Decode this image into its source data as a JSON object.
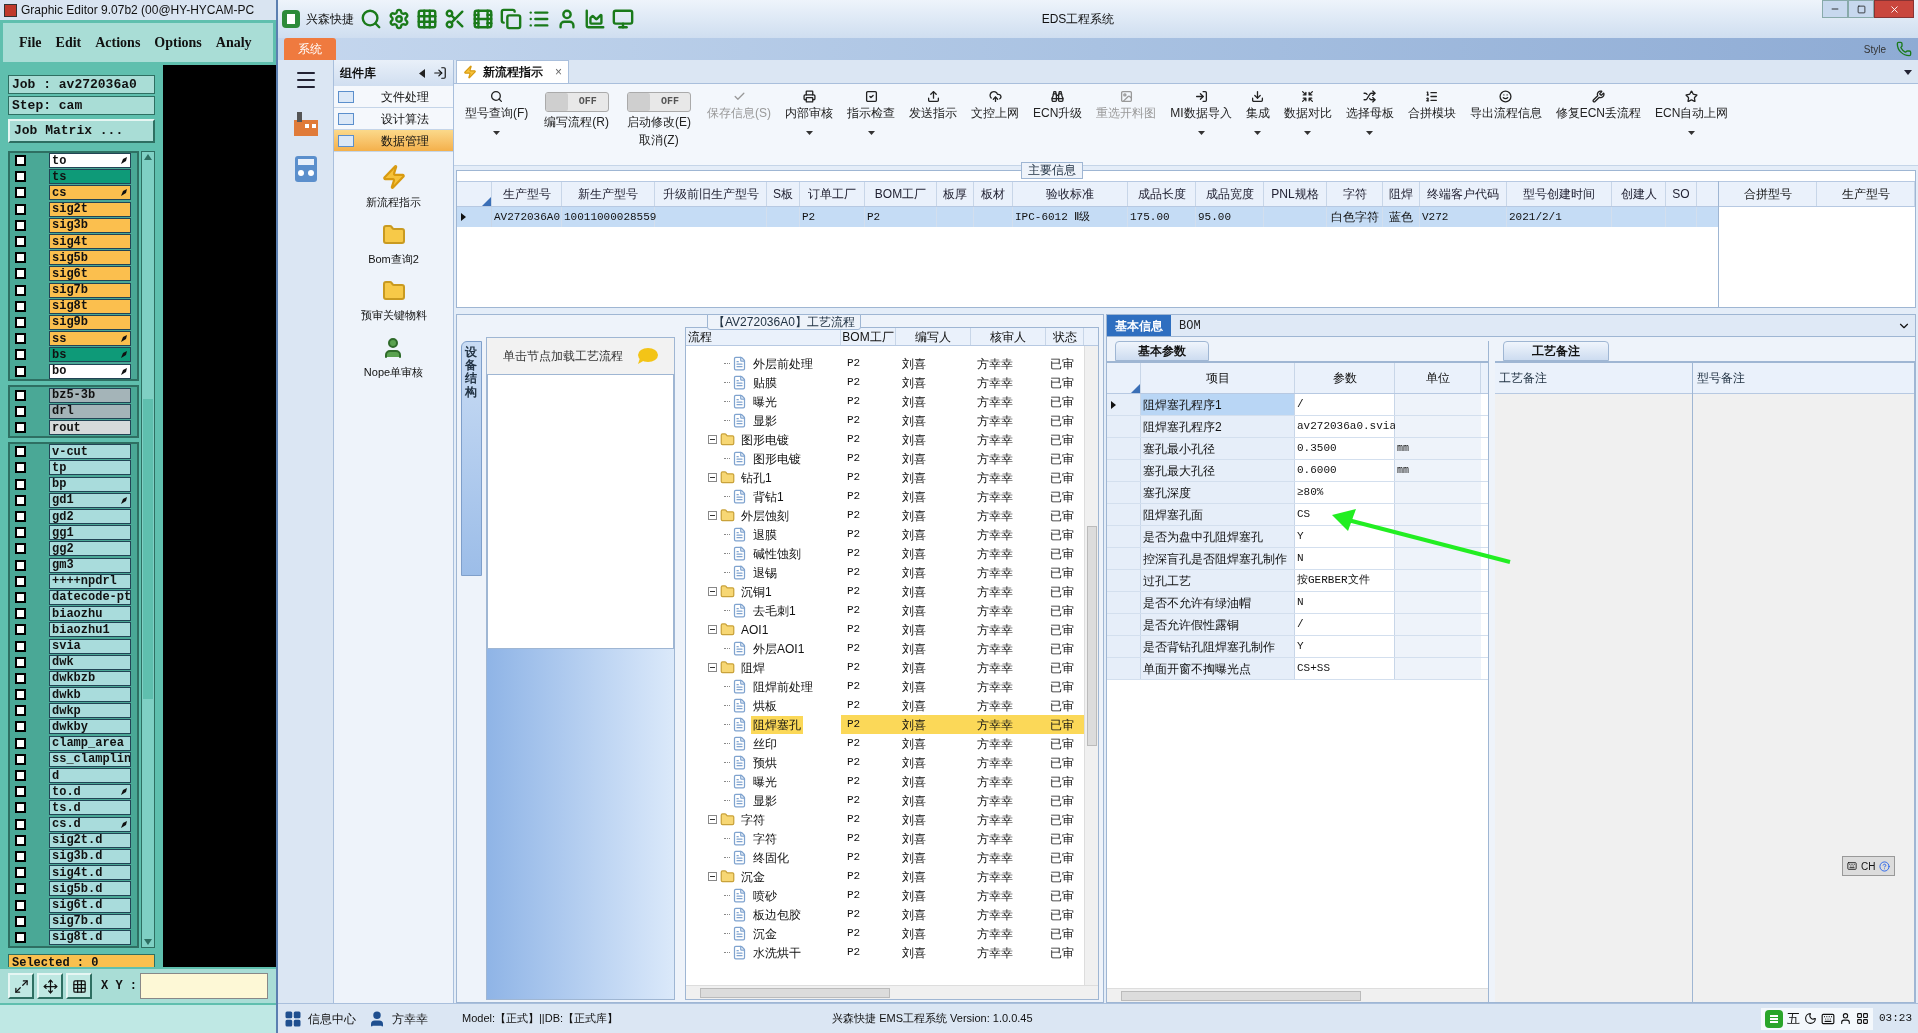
{
  "editor": {
    "title": "Graphic Editor 9.07b2 (00@HY-HYCAM-PC",
    "menu": [
      "File",
      "Edit",
      "Actions",
      "Options",
      "Analy"
    ],
    "job": "Job : av272036a0",
    "step": "Step: cam",
    "matrix_button": "Job Matrix ...",
    "layer_groups": [
      [
        {
          "name": "to",
          "color": "#ffffff",
          "flag": true,
          "checked": false
        },
        {
          "name": "ts",
          "color": "#0e9a78",
          "flag": false,
          "checked": false
        },
        {
          "name": "cs",
          "color": "#fbbf4e",
          "flag": true,
          "checked": false
        },
        {
          "name": "sig2t",
          "color": "#fbbf4e",
          "flag": false,
          "checked": false
        },
        {
          "name": "sig3b",
          "color": "#fbbf4e",
          "flag": false,
          "checked": false
        },
        {
          "name": "sig4t",
          "color": "#fbbf4e",
          "flag": false,
          "checked": false
        },
        {
          "name": "sig5b",
          "color": "#fbbf4e",
          "flag": false,
          "checked": false
        },
        {
          "name": "sig6t",
          "color": "#fbbf4e",
          "flag": false,
          "checked": false
        },
        {
          "name": "sig7b",
          "color": "#fbbf4e",
          "flag": false,
          "checked": false
        },
        {
          "name": "sig8t",
          "color": "#fbbf4e",
          "flag": false,
          "checked": false
        },
        {
          "name": "sig9b",
          "color": "#fbbf4e",
          "flag": false,
          "checked": false
        },
        {
          "name": "ss",
          "color": "#fbbf4e",
          "flag": true,
          "checked": false
        },
        {
          "name": "bs",
          "color": "#0e9a78",
          "flag": true,
          "checked": false
        },
        {
          "name": "bo",
          "color": "#ffffff",
          "flag": true,
          "checked": false
        }
      ],
      [
        {
          "name": "bz5-3b",
          "color": "#a4b4b8",
          "flag": false,
          "checked": false
        },
        {
          "name": "drl",
          "color": "#a4b4b8",
          "flag": false,
          "checked": false
        },
        {
          "name": "rout",
          "color": "#d6dadb",
          "flag": false,
          "checked": false
        }
      ],
      [
        {
          "name": "v-cut",
          "color": "#a9dcdc",
          "flag": false,
          "checked": false
        },
        {
          "name": "tp",
          "color": "#a9dcdc",
          "flag": false,
          "checked": false
        },
        {
          "name": "bp",
          "color": "#a9dcdc",
          "flag": false,
          "checked": false
        },
        {
          "name": "gd1",
          "color": "#a9dcdc",
          "flag": true,
          "checked": false
        },
        {
          "name": "gd2",
          "color": "#a9dcdc",
          "flag": false,
          "checked": false
        },
        {
          "name": "gg1",
          "color": "#a9dcdc",
          "flag": false,
          "checked": false
        },
        {
          "name": "gg2",
          "color": "#a9dcdc",
          "flag": false,
          "checked": false
        },
        {
          "name": "gm3",
          "color": "#a9dcdc",
          "flag": false,
          "checked": false
        },
        {
          "name": "++++npdrl",
          "color": "#a9dcdc",
          "flag": false,
          "checked": false
        },
        {
          "name": "datecode-pt",
          "color": "#a9dcdc",
          "flag": false,
          "checked": false
        },
        {
          "name": "biaozhu",
          "color": "#a9dcdc",
          "flag": false,
          "checked": false
        },
        {
          "name": "biaozhu1",
          "color": "#a9dcdc",
          "flag": false,
          "checked": false
        },
        {
          "name": "svia",
          "color": "#a9dcdc",
          "flag": false,
          "checked": false
        },
        {
          "name": "dwk",
          "color": "#a9dcdc",
          "flag": false,
          "checked": false
        },
        {
          "name": "dwkbzb",
          "color": "#a9dcdc",
          "flag": false,
          "checked": false
        },
        {
          "name": "dwkb",
          "color": "#a9dcdc",
          "flag": false,
          "checked": false
        },
        {
          "name": "dwkp",
          "color": "#a9dcdc",
          "flag": false,
          "checked": false
        },
        {
          "name": "dwkby",
          "color": "#a9dcdc",
          "flag": false,
          "checked": false
        },
        {
          "name": "clamp_area",
          "color": "#a9dcdc",
          "flag": false,
          "checked": false
        },
        {
          "name": "ss_clamplin",
          "color": "#a9dcdc",
          "flag": false,
          "checked": false
        },
        {
          "name": "d",
          "color": "#a9dcdc",
          "flag": false,
          "checked": false
        },
        {
          "name": "to.d",
          "color": "#a9dcdc",
          "flag": true,
          "checked": false
        },
        {
          "name": "ts.d",
          "color": "#a9dcdc",
          "flag": false,
          "checked": false
        },
        {
          "name": "cs.d",
          "color": "#a9dcdc",
          "flag": true,
          "checked": false
        },
        {
          "name": "sig2t.d",
          "color": "#a9dcdc",
          "flag": false,
          "checked": false
        },
        {
          "name": "sig3b.d",
          "color": "#a9dcdc",
          "flag": false,
          "checked": false
        },
        {
          "name": "sig4t.d",
          "color": "#a9dcdc",
          "flag": false,
          "checked": false
        },
        {
          "name": "sig5b.d",
          "color": "#a9dcdc",
          "flag": false,
          "checked": false
        },
        {
          "name": "sig6t.d",
          "color": "#a9dcdc",
          "flag": false,
          "checked": false
        },
        {
          "name": "sig7b.d",
          "color": "#a9dcdc",
          "flag": false,
          "checked": false
        },
        {
          "name": "sig8t.d",
          "color": "#a9dcdc",
          "flag": false,
          "checked": false
        }
      ]
    ],
    "selected": "Selected : 0",
    "xy_label": "X Y :"
  },
  "eds": {
    "app_name": "兴森快捷",
    "window_title": "EDS工程系统",
    "system_tab": "系统",
    "style_label": "Style",
    "component_title": "组件库",
    "nav_items": [
      {
        "label": "文件处理",
        "selected": false
      },
      {
        "label": "设计算法",
        "selected": false
      },
      {
        "label": "数据管理",
        "selected": true
      }
    ],
    "tools": [
      {
        "label": "新流程指示",
        "kind": "bolt"
      },
      {
        "label": "Bom查询2",
        "kind": "folder"
      },
      {
        "label": "预审关键物料",
        "kind": "folder"
      },
      {
        "label": "Nope单审核",
        "kind": "user"
      }
    ],
    "doc_tab": {
      "label": "新流程指示",
      "close": "×"
    },
    "ribbon": [
      {
        "kind": "button",
        "lines": [
          "型号查询(F)"
        ],
        "dropdown": true,
        "disabled": false
      },
      {
        "kind": "toggle",
        "lines": [
          "编写流程(R)"
        ],
        "switch_text": "OFF",
        "on": false
      },
      {
        "kind": "toggle",
        "lines": [
          "启动修改(E)",
          "取消(Z)"
        ],
        "switch_text": "OFF",
        "on": false
      },
      {
        "kind": "button",
        "lines": [
          "保存信息(S)"
        ],
        "dropdown": false,
        "disabled": true
      },
      {
        "kind": "button",
        "lines": [
          "内部审核"
        ],
        "dropdown": true,
        "disabled": false
      },
      {
        "kind": "button",
        "lines": [
          "指示检查"
        ],
        "dropdown": true,
        "disabled": false
      },
      {
        "kind": "button",
        "lines": [
          "发送指示"
        ],
        "dropdown": false,
        "disabled": false
      },
      {
        "kind": "button",
        "lines": [
          "文控上网"
        ],
        "dropdown": false,
        "disabled": false
      },
      {
        "kind": "button",
        "lines": [
          "ECN升级"
        ],
        "dropdown": false,
        "disabled": false
      },
      {
        "kind": "button",
        "lines": [
          "重选开料图"
        ],
        "dropdown": false,
        "disabled": true
      },
      {
        "kind": "button",
        "lines": [
          "MI数据导入"
        ],
        "dropdown": true,
        "disabled": false
      },
      {
        "kind": "button",
        "lines": [
          "集成"
        ],
        "dropdown": true,
        "disabled": false
      },
      {
        "kind": "button",
        "lines": [
          "数据对比"
        ],
        "dropdown": true,
        "disabled": false
      },
      {
        "kind": "button",
        "lines": [
          "选择母板"
        ],
        "dropdown": true,
        "disabled": false
      },
      {
        "kind": "button",
        "lines": [
          "合拼模块"
        ],
        "dropdown": false,
        "disabled": false
      },
      {
        "kind": "button",
        "lines": [
          "导出流程信息"
        ],
        "dropdown": false,
        "disabled": false
      },
      {
        "kind": "button",
        "lines": [
          "修复ECN丢流程"
        ],
        "dropdown": false,
        "disabled": false
      },
      {
        "kind": "button",
        "lines": [
          "ECN自动上网"
        ],
        "dropdown": true,
        "disabled": false
      }
    ],
    "main_info": {
      "title": "主要信息",
      "columns": [
        "生产型号",
        "新生产型号",
        "升级前旧生产型号",
        "S板",
        "订单工厂",
        "BOM工厂",
        "板厚",
        "板材",
        "验收标准",
        "成品长度",
        "成品宽度",
        "PNL规格",
        "字符",
        "阻焊",
        "终端客户代码",
        "型号创建时间",
        "创建人",
        "SO"
      ],
      "rows": [
        {
          "selected": true,
          "cells": [
            "AV272036A0",
            "10011000028559",
            "",
            "",
            "P2",
            "P2",
            "",
            "",
            "IPC-6012 Ⅱ级",
            "175.00",
            "95.00",
            "",
            "白色字符",
            "蓝色",
            "V272",
            "2021/2/1",
            "",
            ""
          ]
        }
      ],
      "side_columns": [
        "合拼型号",
        "生产型号"
      ]
    },
    "flow": {
      "title": "【AV272036A0】工艺流程",
      "side_tab": "设备结构",
      "hint": "单击节点加载工艺流程",
      "columns": [
        "流程",
        "BOM工厂",
        "编写人",
        "核审人",
        "状态"
      ],
      "nodes": [
        {
          "children": [
            {
              "label": "外层前处理",
              "bom": "P2",
              "writer": "刘喜",
              "reviewer": "方幸幸",
              "status": "已审",
              "selected": false
            },
            {
              "label": "贴膜",
              "bom": "P2",
              "writer": "刘喜",
              "reviewer": "方幸幸",
              "status": "已审",
              "selected": false
            },
            {
              "label": "曝光",
              "bom": "P2",
              "writer": "刘喜",
              "reviewer": "方幸幸",
              "status": "已审",
              "selected": false
            },
            {
              "label": "显影",
              "bom": "P2",
              "writer": "刘喜",
              "reviewer": "方幸幸",
              "status": "已审",
              "selected": false
            }
          ]
        },
        {
          "label": "图形电镀",
          "bom": "P2",
          "writer": "刘喜",
          "reviewer": "方幸幸",
          "status": "已审",
          "selected": false,
          "children": [
            {
              "label": "图形电镀",
              "bom": "P2",
              "writer": "刘喜",
              "reviewer": "方幸幸",
              "status": "已审",
              "selected": false
            }
          ]
        },
        {
          "label": "钻孔1",
          "bom": "P2",
          "writer": "刘喜",
          "reviewer": "方幸幸",
          "status": "已审",
          "selected": false,
          "children": [
            {
              "label": "背钻1",
              "bom": "P2",
              "writer": "刘喜",
              "reviewer": "方幸幸",
              "status": "已审",
              "selected": false
            }
          ]
        },
        {
          "label": "外层蚀刻",
          "bom": "P2",
          "writer": "刘喜",
          "reviewer": "方幸幸",
          "status": "已审",
          "selected": false,
          "children": [
            {
              "label": "退膜",
              "bom": "P2",
              "writer": "刘喜",
              "reviewer": "方幸幸",
              "status": "已审",
              "selected": false
            },
            {
              "label": "碱性蚀刻",
              "bom": "P2",
              "writer": "刘喜",
              "reviewer": "方幸幸",
              "status": "已审",
              "selected": false
            },
            {
              "label": "退锡",
              "bom": "P2",
              "writer": "刘喜",
              "reviewer": "方幸幸",
              "status": "已审",
              "selected": false
            }
          ]
        },
        {
          "label": "沉铜1",
          "bom": "P2",
          "writer": "刘喜",
          "reviewer": "方幸幸",
          "status": "已审",
          "selected": false,
          "children": [
            {
              "label": "去毛刺1",
              "bom": "P2",
              "writer": "刘喜",
              "reviewer": "方幸幸",
              "status": "已审",
              "selected": false
            }
          ]
        },
        {
          "label": "AOI1",
          "bom": "P2",
          "writer": "刘喜",
          "reviewer": "方幸幸",
          "status": "已审",
          "selected": false,
          "children": [
            {
              "label": "外层AOI1",
              "bom": "P2",
              "writer": "刘喜",
              "reviewer": "方幸幸",
              "status": "已审",
              "selected": false
            }
          ]
        },
        {
          "label": "阻焊",
          "bom": "P2",
          "writer": "刘喜",
          "reviewer": "方幸幸",
          "status": "已审",
          "selected": false,
          "children": [
            {
              "label": "阻焊前处理",
              "bom": "P2",
              "writer": "刘喜",
              "reviewer": "方幸幸",
              "status": "已审",
              "selected": false
            },
            {
              "label": "烘板",
              "bom": "P2",
              "writer": "刘喜",
              "reviewer": "方幸幸",
              "status": "已审",
              "selected": false
            },
            {
              "label": "阻焊塞孔",
              "bom": "P2",
              "writer": "刘喜",
              "reviewer": "方幸幸",
              "status": "已审",
              "selected": true
            },
            {
              "label": "丝印",
              "bom": "P2",
              "writer": "刘喜",
              "reviewer": "方幸幸",
              "status": "已审",
              "selected": false
            },
            {
              "label": "预烘",
              "bom": "P2",
              "writer": "刘喜",
              "reviewer": "方幸幸",
              "status": "已审",
              "selected": false
            },
            {
              "label": "曝光",
              "bom": "P2",
              "writer": "刘喜",
              "reviewer": "方幸幸",
              "status": "已审",
              "selected": false
            },
            {
              "label": "显影",
              "bom": "P2",
              "writer": "刘喜",
              "reviewer": "方幸幸",
              "status": "已审",
              "selected": false
            }
          ]
        },
        {
          "label": "字符",
          "bom": "P2",
          "writer": "刘喜",
          "reviewer": "方幸幸",
          "status": "已审",
          "selected": false,
          "children": [
            {
              "label": "字符",
              "bom": "P2",
              "writer": "刘喜",
              "reviewer": "方幸幸",
              "status": "已审",
              "selected": false
            },
            {
              "label": "终固化",
              "bom": "P2",
              "writer": "刘喜",
              "reviewer": "方幸幸",
              "status": "已审",
              "selected": false
            }
          ]
        },
        {
          "label": "沉金",
          "bom": "P2",
          "writer": "刘喜",
          "reviewer": "方幸幸",
          "status": "已审",
          "selected": false,
          "children": [
            {
              "label": "喷砂",
              "bom": "P2",
              "writer": "刘喜",
              "reviewer": "方幸幸",
              "status": "已审",
              "selected": false
            },
            {
              "label": "板边包胶",
              "bom": "P2",
              "writer": "刘喜",
              "reviewer": "方幸幸",
              "status": "已审",
              "selected": false
            },
            {
              "label": "沉金",
              "bom": "P2",
              "writer": "刘喜",
              "reviewer": "方幸幸",
              "status": "已审",
              "selected": false
            },
            {
              "label": "水洗烘干",
              "bom": "P2",
              "writer": "刘喜",
              "reviewer": "方幸幸",
              "status": "已审",
              "selected": false
            }
          ]
        }
      ]
    },
    "info": {
      "tabs": [
        {
          "label": "基本信息",
          "selected": true
        },
        {
          "label": "BOM",
          "selected": false
        }
      ],
      "params_tab": "基本参数",
      "columns": [
        "项目",
        "参数",
        "单位"
      ],
      "rows": [
        {
          "item": "阻焊塞孔程序1",
          "value": "/",
          "unit": "",
          "selected": true
        },
        {
          "item": "阻焊塞孔程序2",
          "value": "av272036a0.svia",
          "unit": "",
          "selected": false
        },
        {
          "item": "塞孔最小孔径",
          "value": "0.3500",
          "unit": "mm",
          "selected": false
        },
        {
          "item": "塞孔最大孔径",
          "value": "0.6000",
          "unit": "mm",
          "selected": false
        },
        {
          "item": "塞孔深度",
          "value": "≥80%",
          "unit": "",
          "selected": false
        },
        {
          "item": "阻焊塞孔面",
          "value": "CS",
          "unit": "",
          "selected": false
        },
        {
          "item": "是否为盘中孔阻焊塞孔",
          "value": "Y",
          "unit": "",
          "selected": false
        },
        {
          "item": "控深盲孔是否阻焊塞孔制作",
          "value": "N",
          "unit": "",
          "selected": false
        },
        {
          "item": "过孔工艺",
          "value": "按GERBER文件",
          "unit": "",
          "selected": false
        },
        {
          "item": "是否不允许有绿油帽",
          "value": "N",
          "unit": "",
          "selected": false
        },
        {
          "item": "是否允许假性露铜",
          "value": "/",
          "unit": "",
          "selected": false
        },
        {
          "item": "是否背钻孔阻焊塞孔制作",
          "value": "Y",
          "unit": "",
          "selected": false
        },
        {
          "item": "单面开窗不掏曝光点",
          "value": "CS+SS",
          "unit": "",
          "selected": false
        }
      ],
      "remarks_tab": "工艺备注",
      "remarks_columns": [
        "工艺备注",
        "型号备注"
      ]
    },
    "language_bar": "CH",
    "status": {
      "center": "信息中心",
      "user": "方幸幸",
      "model": "Model:【正式】||DB:【正式库】",
      "version": "兴森快捷 EMS工程系统 Version: 1.0.0.45",
      "ime": "五",
      "time": "03:23"
    }
  }
}
